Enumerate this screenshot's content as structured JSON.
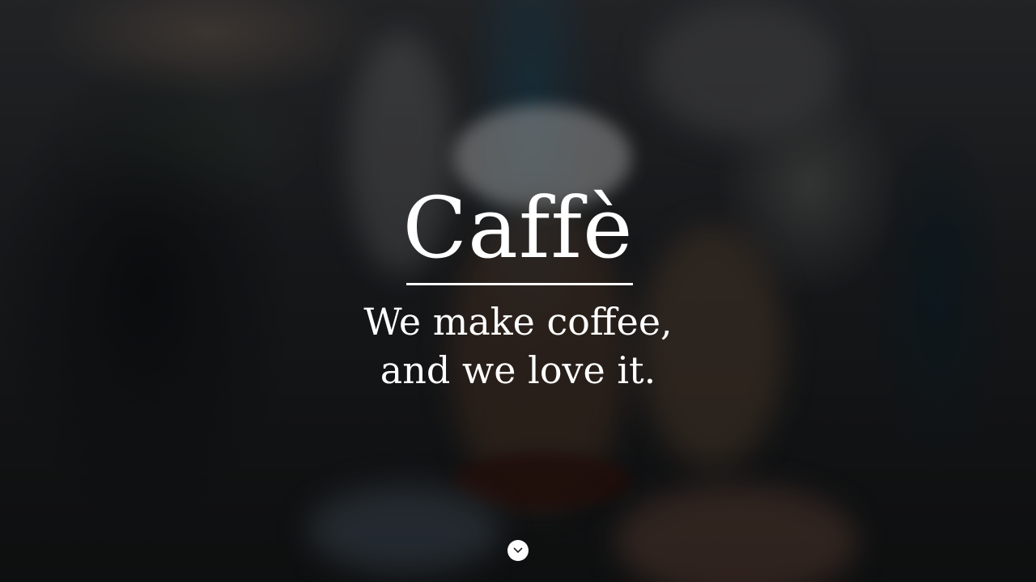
{
  "hero": {
    "title": "Caffè",
    "tagline_line1": "We make coffee,",
    "tagline_line2": "and we love it.",
    "scroll_button_icon": "chevron-down-icon"
  },
  "colors": {
    "text": "#ffffff",
    "overlay": "#0a0a0c"
  }
}
